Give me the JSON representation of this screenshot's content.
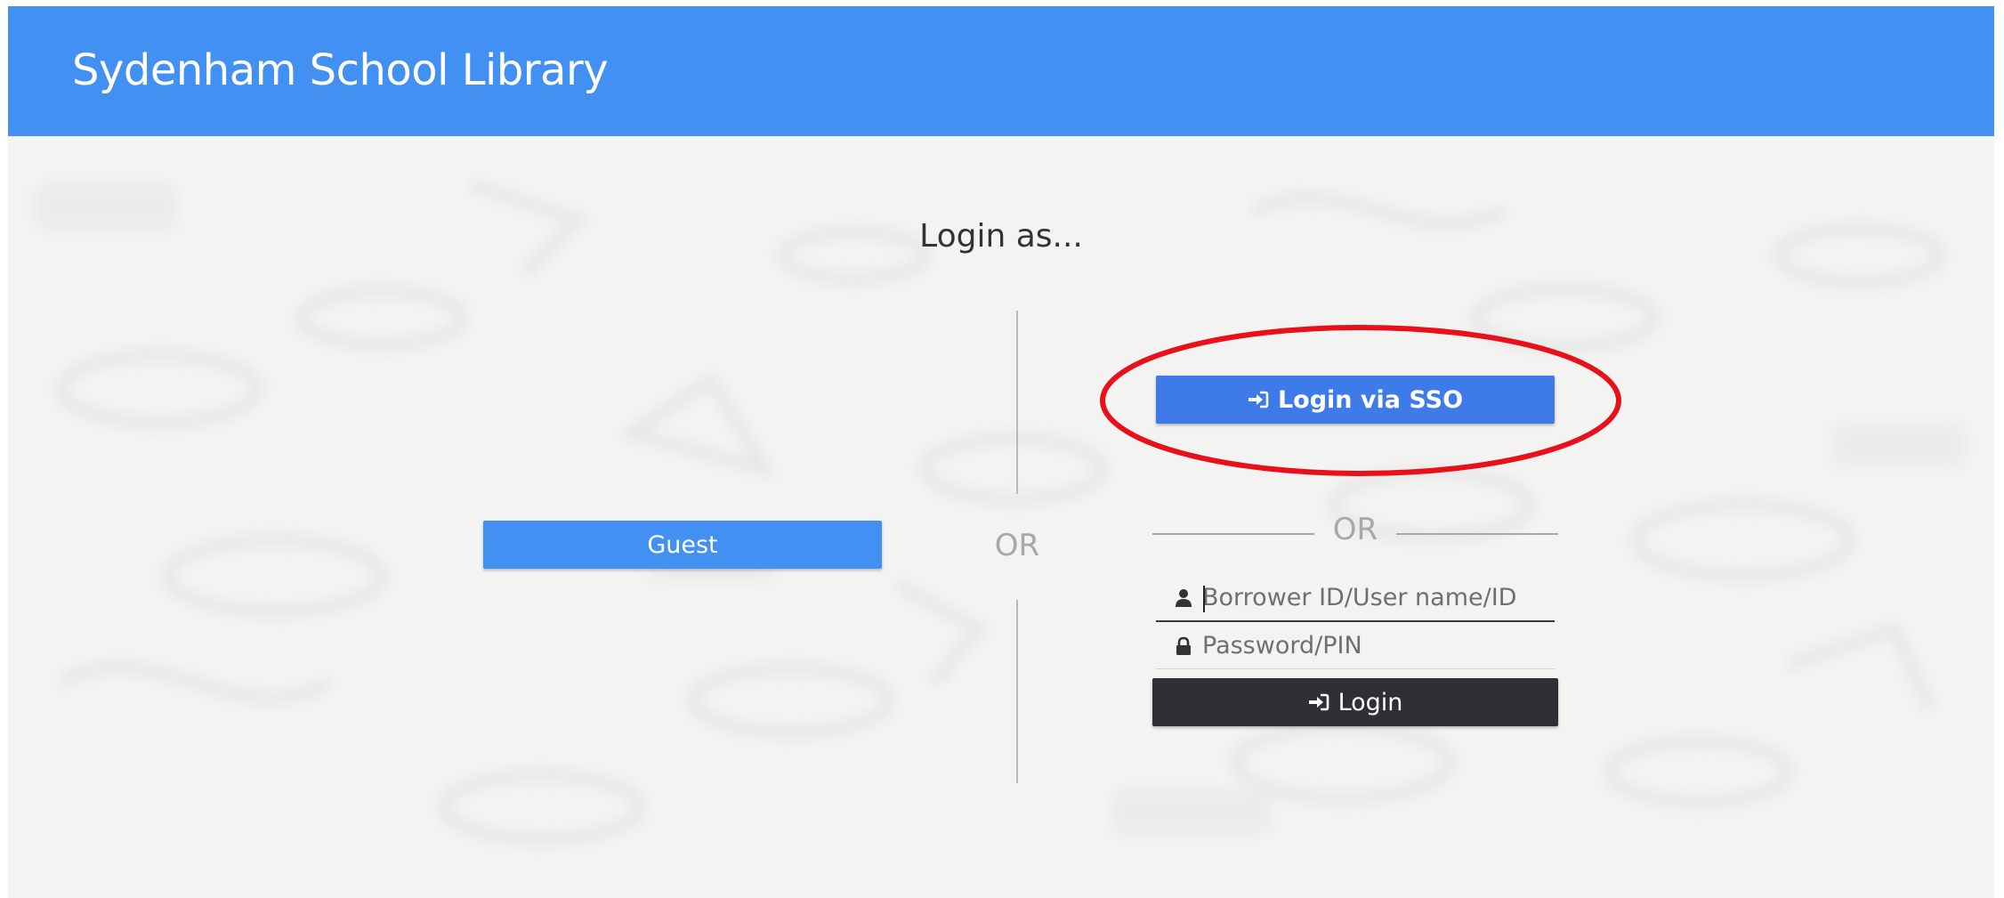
{
  "header": {
    "title": "Sydenham School Library"
  },
  "main": {
    "heading": "Login as...",
    "divider_label": "OR",
    "guest_button_label": "Guest",
    "sso_button_label": "Login via SSO",
    "or_label": "OR",
    "username_placeholder": "Borrower ID/User name/ID",
    "password_placeholder": "Password/PIN",
    "login_button_label": "Login"
  },
  "icons": {
    "sso": "sign-in-icon",
    "login": "sign-in-icon",
    "username": "user-icon",
    "password": "lock-icon"
  },
  "colors": {
    "header_bg": "#4290f2",
    "guest_button": "#4290f2",
    "sso_button": "#3f7be8",
    "login_button": "#2f2f35",
    "annotation": "#e8101a"
  }
}
